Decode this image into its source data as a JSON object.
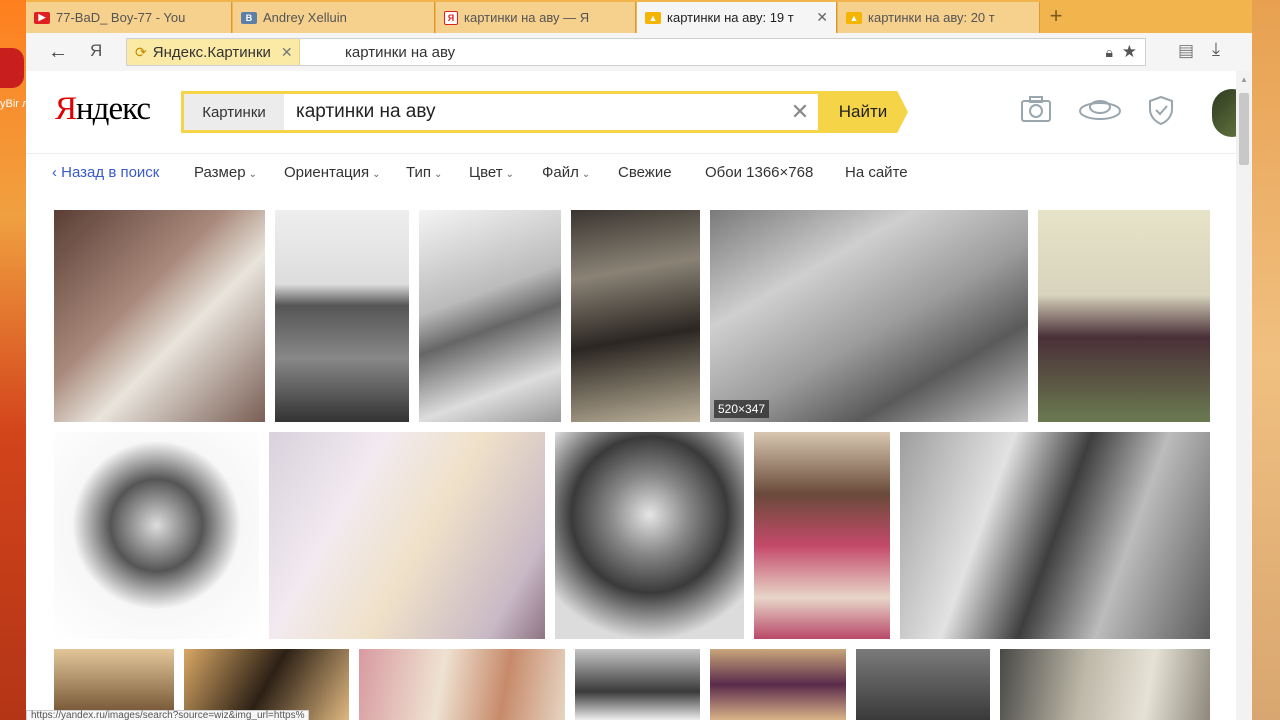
{
  "desktop": {
    "app_label": "yBir\nллы"
  },
  "tabs": [
    {
      "title": "77-BaD_ Boy-77 - You",
      "favicon": "youtube-icon",
      "active": false
    },
    {
      "title": "Andrey Xelluin",
      "favicon": "vk-icon",
      "active": false
    },
    {
      "title": "картинки на аву — Я",
      "favicon": "yandex-icon",
      "active": false
    },
    {
      "title": "картинки на аву: 19 т",
      "favicon": "image-icon",
      "active": true
    },
    {
      "title": "картинки на аву: 20 т",
      "favicon": "image-icon",
      "active": false
    }
  ],
  "address": {
    "site_chip": "Яндекс.Картинки",
    "url_text": "картинки на аву"
  },
  "logo": {
    "first": "Я",
    "rest": "ндекс"
  },
  "search": {
    "service": "Картинки",
    "query": "картинки на аву",
    "button": "Найти"
  },
  "filters": [
    {
      "label": "Назад в поиск",
      "type": "back"
    },
    {
      "label": "Размер",
      "dropdown": true
    },
    {
      "label": "Ориентация",
      "dropdown": true
    },
    {
      "label": "Тип",
      "dropdown": true
    },
    {
      "label": "Цвет",
      "dropdown": true
    },
    {
      "label": "Файл",
      "dropdown": true
    },
    {
      "label": "Свежие",
      "dropdown": false
    },
    {
      "label": "Обои 1366×768",
      "dropdown": false
    },
    {
      "label": "На сайте",
      "dropdown": false
    }
  ],
  "images": {
    "hover_size": "520×347"
  },
  "status_bar": {
    "url": "https://yandex.ru/images/search?source=wiz&img_url=https%"
  },
  "colors": {
    "accent": "#f5d547",
    "tabstrip": "#f2b54e",
    "link": "#3a5bc9",
    "brand_red": "#e00000"
  }
}
